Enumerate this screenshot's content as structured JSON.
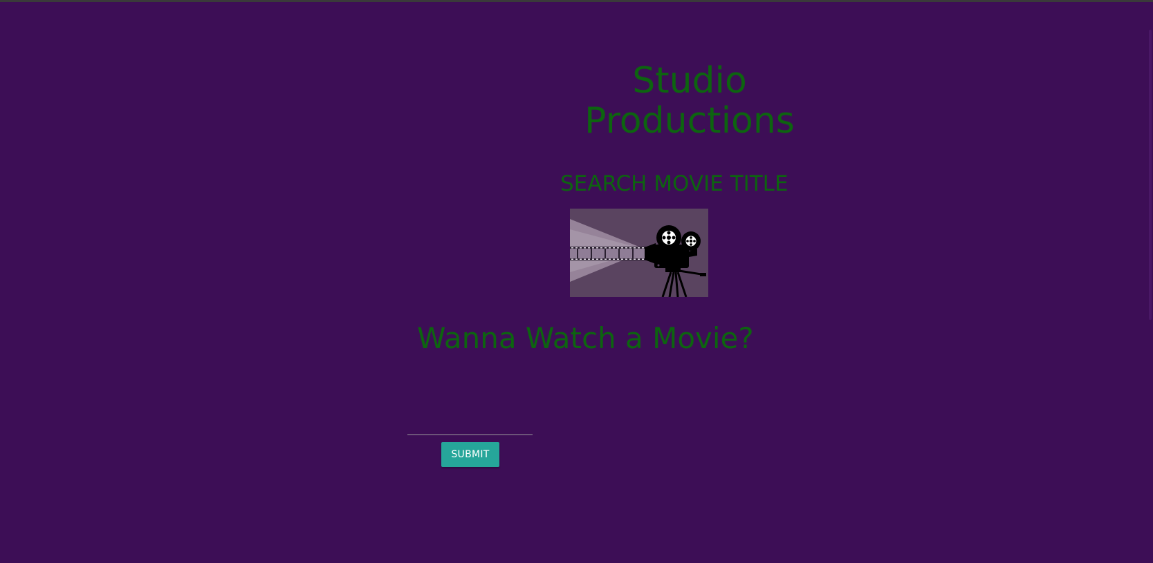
{
  "header": {
    "brand_title": "Studio Productions",
    "search_heading": "SEARCH MOVIE TITLE"
  },
  "hero": {
    "image_icon": "movie-projector-camera-icon",
    "question": "Wanna Watch a Movie?"
  },
  "search_form": {
    "input_value": "",
    "input_placeholder": "",
    "submit_label": "SUBMIT"
  },
  "colors": {
    "background": "#3d0e56",
    "heading_text": "#0d6410",
    "button": "#26a69a",
    "button_text": "#ffffff",
    "image_background": "#5a4460"
  }
}
